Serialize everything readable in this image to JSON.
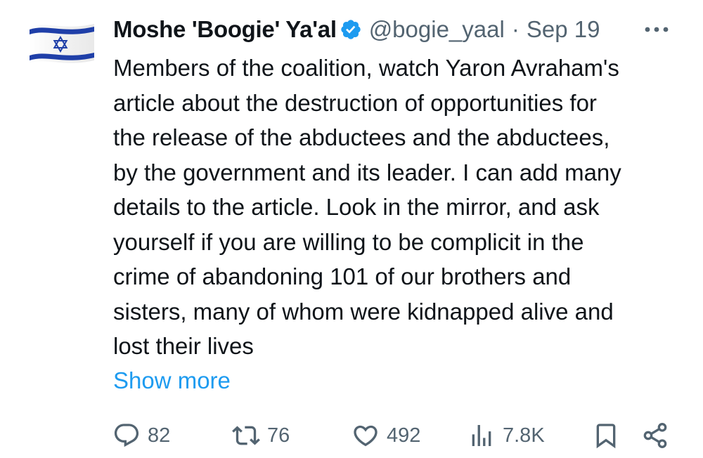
{
  "author": {
    "display_name": "Moshe 'Boogie' Ya'al",
    "verified": true,
    "handle": "@bogie_yaal",
    "separator": "·",
    "date": "Sep 19"
  },
  "tweet": {
    "lines": [
      "Members of the coalition, watch Yaron Avraham's",
      "article about the destruction of opportunities for",
      "the release of the abductees and the abductees,",
      "by the government and its leader. I can add many",
      "details to the article. Look in the mirror, and ask",
      "yourself if you are willing to be complicit in the",
      "crime of abandoning 101 of our brothers and",
      "sisters, many of whom were kidnapped alive and",
      "lost their lives"
    ],
    "show_more_label": "Show more"
  },
  "actions": {
    "reply_count": "82",
    "retweet_count": "76",
    "like_count": "492",
    "views_count": "7.8K"
  },
  "icons": {
    "avatar": "israel-flag-icon",
    "verified": "verified-badge-icon",
    "more": "more-options-icon",
    "reply": "reply-icon",
    "retweet": "retweet-icon",
    "like": "heart-icon",
    "views": "views-icon",
    "bookmark": "bookmark-icon",
    "share": "share-icon"
  },
  "colors": {
    "text_primary": "#0f1419",
    "text_secondary": "#536471",
    "link": "#1d9bf0",
    "verified_badge": "#1d9bf0",
    "flag_blue": "#1f3fa8"
  }
}
